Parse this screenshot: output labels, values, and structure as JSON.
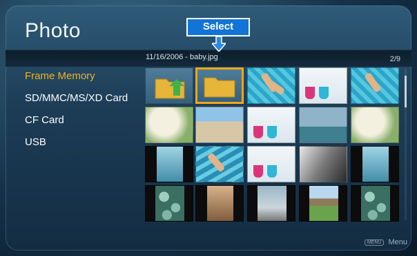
{
  "header": {
    "title": "Photo"
  },
  "callout": {
    "label": "Select"
  },
  "info": {
    "date_file": "11/16/2006 - baby.jpg",
    "page": "2/9"
  },
  "sources": [
    {
      "label": "Frame Memory",
      "active": true
    },
    {
      "label": "SD/MMC/MS/XD Card",
      "active": false
    },
    {
      "label": "CF Card",
      "active": false
    },
    {
      "label": "USB",
      "active": false
    }
  ],
  "footer": {
    "menu_key": "MENU",
    "menu_label": "Menu"
  },
  "colors": {
    "accent": "#f5a51b",
    "callout": "#1274d6",
    "title": "#f2f6f9"
  }
}
